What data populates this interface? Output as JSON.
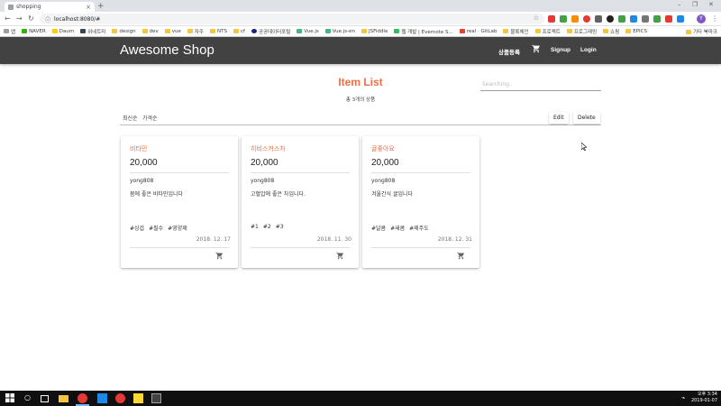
{
  "browser": {
    "tab_title": "shopping",
    "url": "localhost:8080/#",
    "bookmarks": [
      "앱",
      "NAVER",
      "Daum",
      "위네트미",
      "design",
      "dev",
      "vue",
      "자주",
      "NTS",
      "cf",
      "공공데이터포털",
      "Vue.js",
      "Vue.js-en",
      "JSFiddle",
      "웹 개발 | Evernote S...",
      "real · GitLab",
      "블록체인",
      "프로젝트",
      "프로그래밍",
      "쇼핑",
      "EPICS"
    ],
    "other_bookmarks": "기타 북마크",
    "profile_initial": "Y"
  },
  "app": {
    "brand": "Awesome Shop",
    "nav": {
      "register": "상품등록",
      "signup": "Signup",
      "login": "Login"
    },
    "heading": "Item List",
    "count_text": "총 3개의 상품",
    "search_placeholder": "Searching..",
    "sort": {
      "latest": "최신순",
      "price": "가격순"
    },
    "actions": {
      "edit": "Edit",
      "delete": "Delete"
    },
    "items": [
      {
        "title": "비타민",
        "price": "20,000",
        "author": "yong808",
        "description": "몸에 좋은 비타민입니다",
        "tags": [
          "#싱겁",
          "#필수",
          "#영양제"
        ],
        "date": "2018. 12. 17"
      },
      {
        "title": "히비스커스차",
        "price": "20,000",
        "author": "yong808",
        "description": "고혈압에 좋은 차입니다.",
        "tags": [
          "#1",
          "#2",
          "#3"
        ],
        "date": "2018. 11. 30"
      },
      {
        "title": "귤좋아요",
        "price": "20,000",
        "author": "yong808",
        "description": "겨울간식 귤입니다",
        "tags": [
          "#달콤",
          "#새콤",
          "#제주도"
        ],
        "date": "2018. 12. 31"
      }
    ]
  },
  "taskbar": {
    "time": "오후 3:34",
    "date": "2019-01-07"
  },
  "colors": {
    "accent": "#f06e45",
    "appbar": "#424242",
    "taskbar": "#101010"
  }
}
